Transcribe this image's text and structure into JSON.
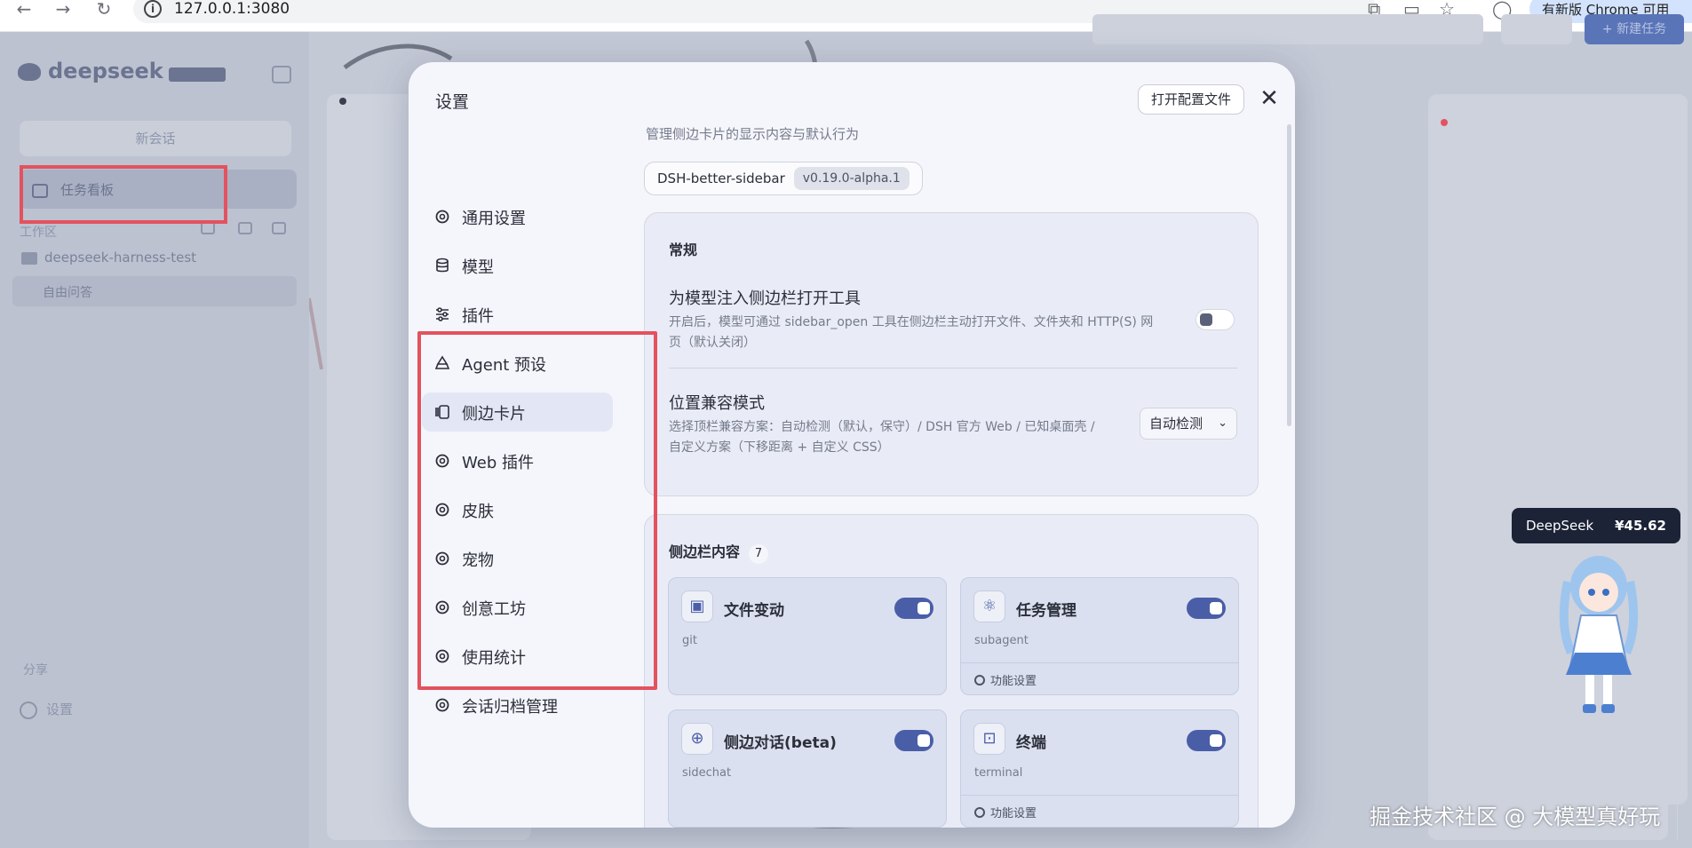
{
  "browser": {
    "url": "127.0.0.1:3080",
    "update_label": "有新版 Chrome 可用"
  },
  "background": {
    "logo": "deepseek",
    "new_chat": "新会话",
    "task_board": "任务看板",
    "section": "工作区",
    "project": "deepseek-harness-test",
    "row": "自由问答",
    "share": "分享",
    "settings": "设置",
    "new_task": "+ 新建任务"
  },
  "widget": {
    "name": "DeepSeek",
    "balance": "¥45.62"
  },
  "watermark": "掘金技术社区 @ 大模型真好玩",
  "modal": {
    "title": "设置",
    "open_config": "打开配置文件",
    "close": "✕",
    "nav": [
      {
        "label": "通用设置",
        "icon": "gear-icon"
      },
      {
        "label": "模型",
        "icon": "database-icon"
      },
      {
        "label": "插件",
        "icon": "sliders-icon"
      },
      {
        "label": "Agent 预设",
        "icon": "recycle-icon"
      },
      {
        "label": "侧边卡片",
        "icon": "sidebar-cards-icon",
        "active": true
      },
      {
        "label": "Web 插件",
        "icon": "gear-icon"
      },
      {
        "label": "皮肤",
        "icon": "gear-icon"
      },
      {
        "label": "宠物",
        "icon": "gear-icon"
      },
      {
        "label": "创意工坊",
        "icon": "gear-icon"
      },
      {
        "label": "使用统计",
        "icon": "gear-icon"
      },
      {
        "label": "会话归档管理",
        "icon": "gear-icon"
      }
    ],
    "content": {
      "description": "管理侧边卡片的显示内容与默认行为",
      "plugin_name": "DSH-better-sidebar",
      "plugin_version": "v0.19.0-alpha.1",
      "general": {
        "heading": "常规",
        "inject_title": "为模型注入侧边栏打开工具",
        "inject_desc_1": "开启后，模型可通过 sidebar_open 工具在侧边栏主动打开文件、文件夹和 HTTP(S) 网",
        "inject_desc_2": "页（默认关闭）",
        "inject_enabled": false,
        "compat_title": "位置兼容模式",
        "compat_desc_1": "选择顶栏兼容方案：自动检测（默认，保守）/ DSH 官方 Web / 已知桌面壳 /",
        "compat_desc_2": "自定义方案（下移距离 + 自定义 CSS）",
        "compat_value": "自动检测"
      },
      "sidebar_content": {
        "heading": "侧边栏内容",
        "count": "7",
        "cards": [
          {
            "title": "文件变动",
            "sub": "git",
            "icon": "file-change-icon",
            "enabled": true,
            "footer": ""
          },
          {
            "title": "任务管理",
            "sub": "subagent",
            "icon": "atom-icon",
            "enabled": true,
            "footer": "功能设置"
          },
          {
            "title": "侧边对话(beta)",
            "sub": "sidechat",
            "icon": "plus-circle-icon",
            "enabled": true,
            "footer": ""
          },
          {
            "title": "终端",
            "sub": "terminal",
            "icon": "terminal-icon",
            "enabled": true,
            "footer": "功能设置"
          }
        ]
      }
    }
  },
  "colors": {
    "accent": "#4a5ea8",
    "highlight_box": "#e3525e"
  }
}
